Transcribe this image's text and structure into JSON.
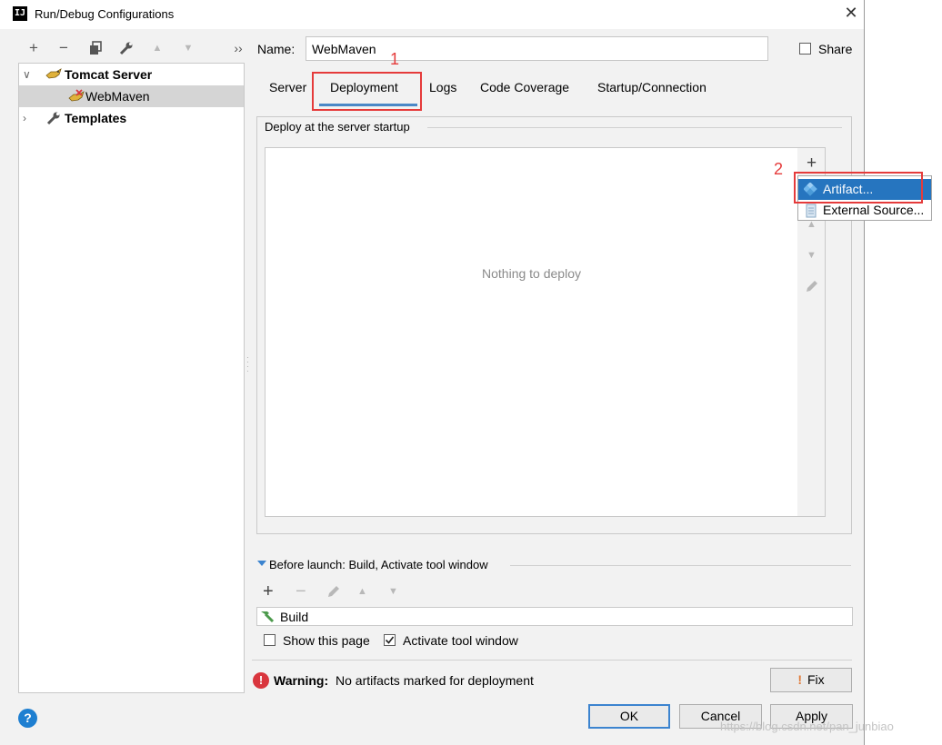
{
  "window": {
    "title": "Run/Debug Configurations",
    "app_icon": "IJ"
  },
  "toolbar": {
    "add": "+",
    "remove": "−",
    "copy_icon": "copy-icon",
    "wrench_icon": "wrench-icon",
    "up": "▲",
    "down": "▼",
    "more": "››"
  },
  "tree": {
    "tomcat": "Tomcat Server",
    "webmaven": "WebMaven",
    "templates": "Templates"
  },
  "name_field": {
    "label": "Name:",
    "value": "WebMaven"
  },
  "share": {
    "label": "Share",
    "checked": false
  },
  "tabs": [
    "Server",
    "Deployment",
    "Logs",
    "Code Coverage",
    "Startup/Connection"
  ],
  "active_tab": "Deployment",
  "annotations": {
    "one": "1",
    "two": "2"
  },
  "deploy": {
    "group_title": "Deploy at the server startup",
    "empty_text": "Nothing to deploy",
    "add_symbol": "+"
  },
  "popup": {
    "items": [
      "Artifact...",
      "External Source..."
    ]
  },
  "before_launch": {
    "title": "Before launch: Build, Activate tool window",
    "build_item": "Build",
    "show_page": "Show this page",
    "activate": "Activate tool window"
  },
  "warning": {
    "bold": "Warning:",
    "text": "No artifacts marked for deployment",
    "fix": "Fix"
  },
  "buttons": {
    "ok": "OK",
    "cancel": "Cancel",
    "apply": "Apply"
  },
  "help": "?",
  "watermark": "https://blog.csdn.net/pan_junbiao",
  "colors": {
    "accent": "#4a88c7",
    "selection": "#2675bf",
    "annotation": "#e53b3b",
    "warning": "#d9363e"
  }
}
